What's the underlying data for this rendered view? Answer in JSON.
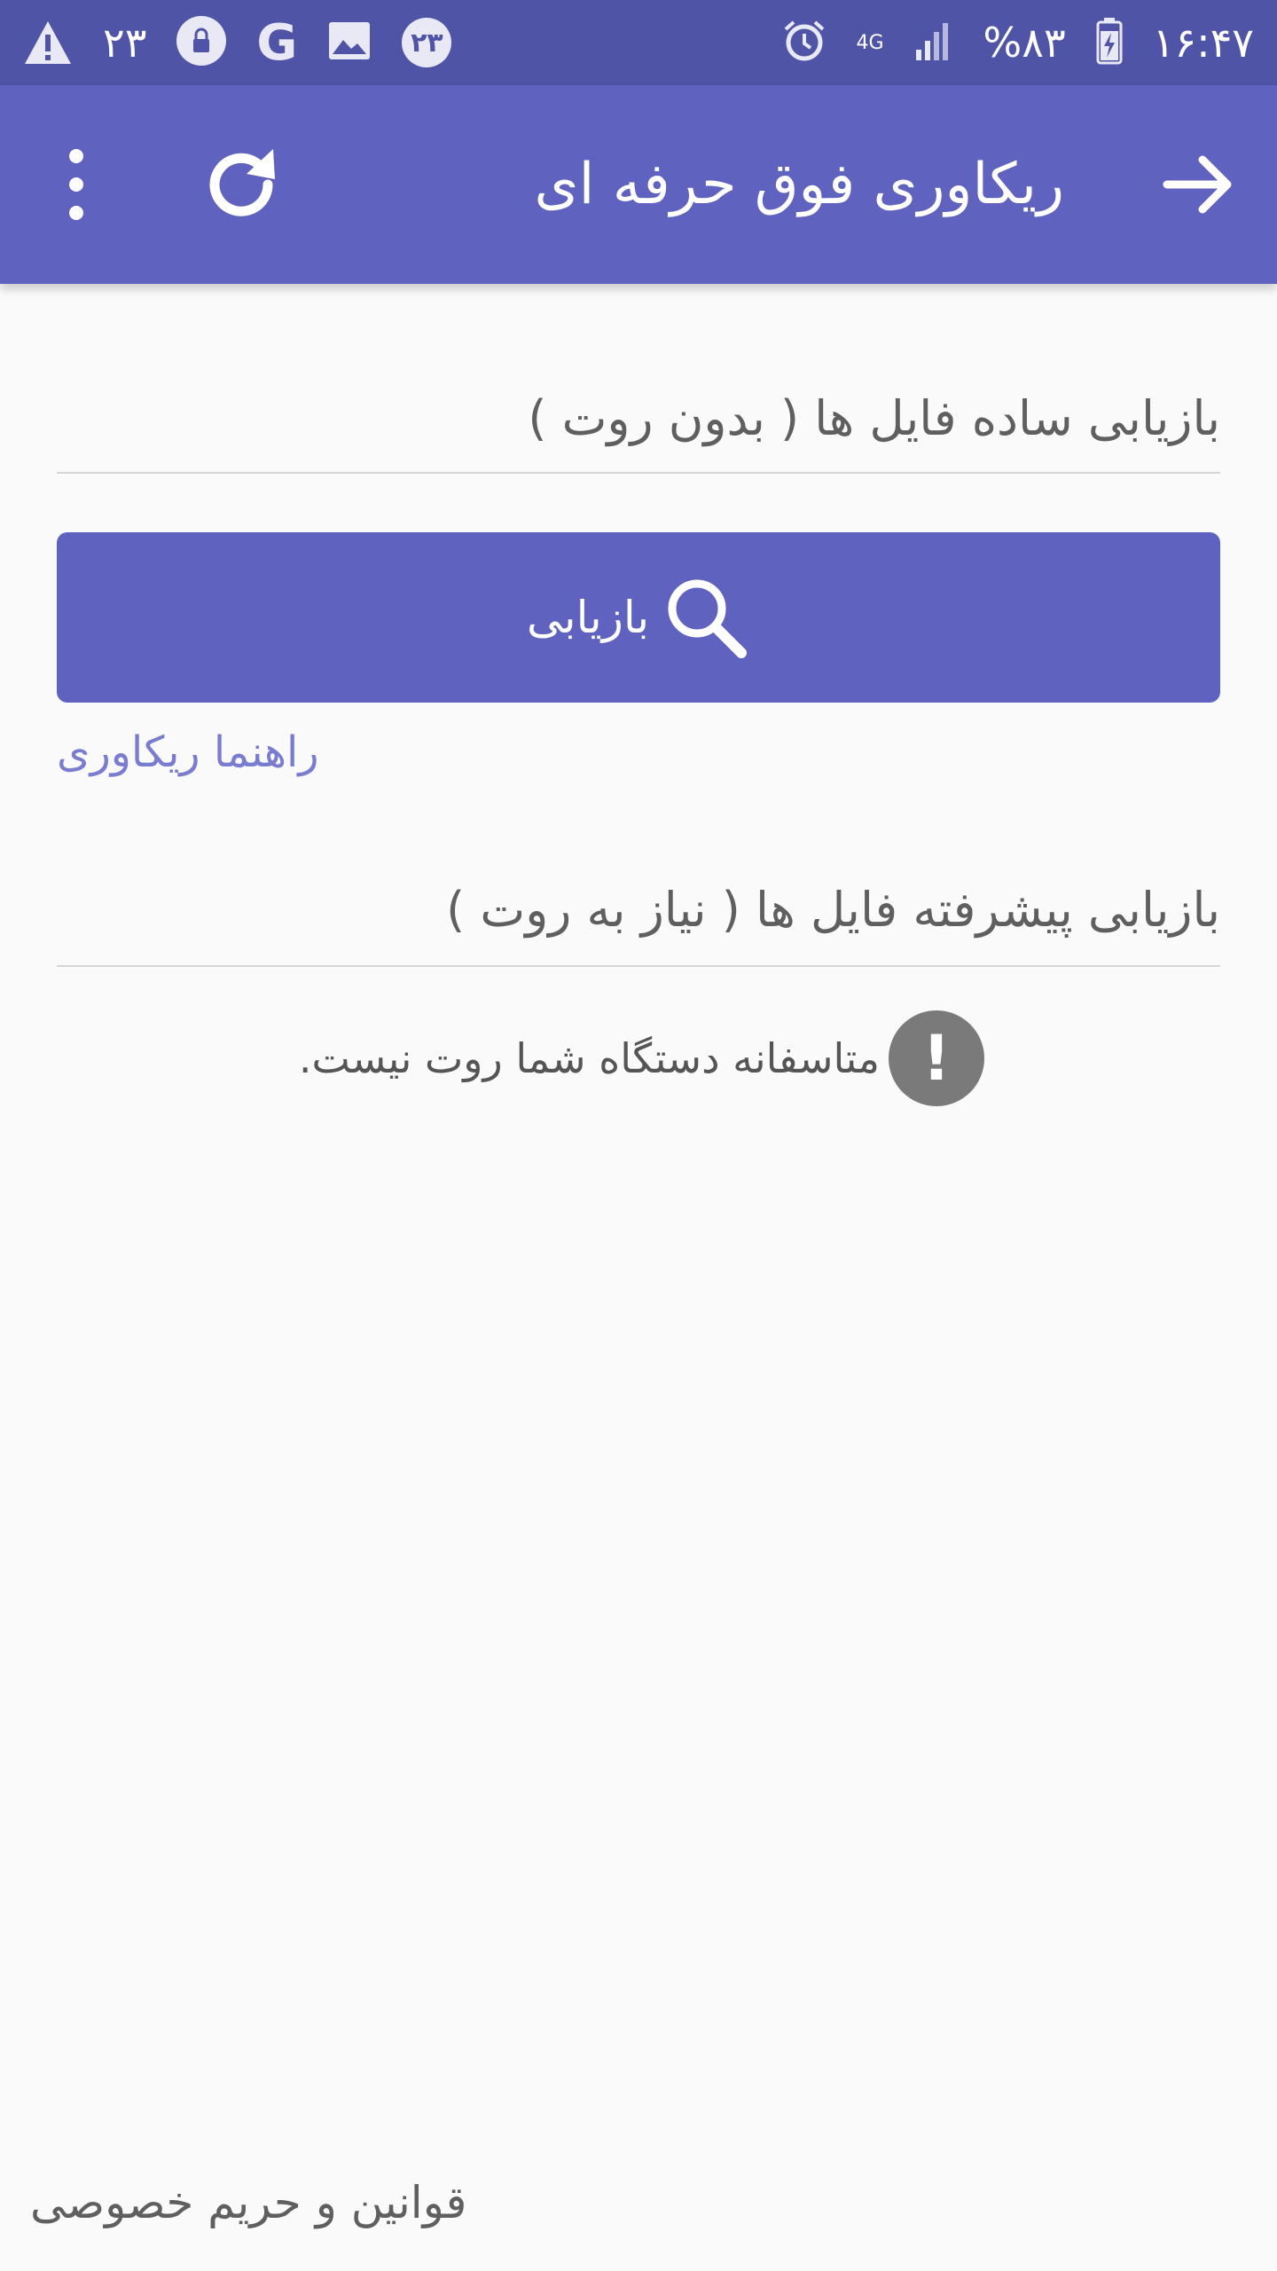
{
  "status_bar": {
    "time": "۱۶:۴۷",
    "battery": "%۸۳",
    "network": "4G",
    "notification_count": "۲۳",
    "notification_badge": "۲۳",
    "icons": [
      "warning-icon",
      "lock-icon",
      "google-icon",
      "image-icon",
      "alarm-icon",
      "signal-icon",
      "battery-icon"
    ]
  },
  "toolbar": {
    "title": "ریکاوری فوق حرفه ای",
    "icons": [
      "back-arrow-icon",
      "refresh-icon",
      "more-vert-icon"
    ],
    "color": "#6062bf"
  },
  "simple_recovery": {
    "title": "بازیابی ساده فایل ها ( بدون روت )",
    "button_label": "بازیابی",
    "guide_link": "راهنما ریکاوری"
  },
  "advanced_recovery": {
    "title": "بازیابی پیشرفته فایل ها ( نیاز به روت )",
    "message": "متاسفانه دستگاه شما روت نیست.",
    "warning_symbol": "!"
  },
  "footer": {
    "terms_link": "قوانین و حریم خصوصی"
  }
}
